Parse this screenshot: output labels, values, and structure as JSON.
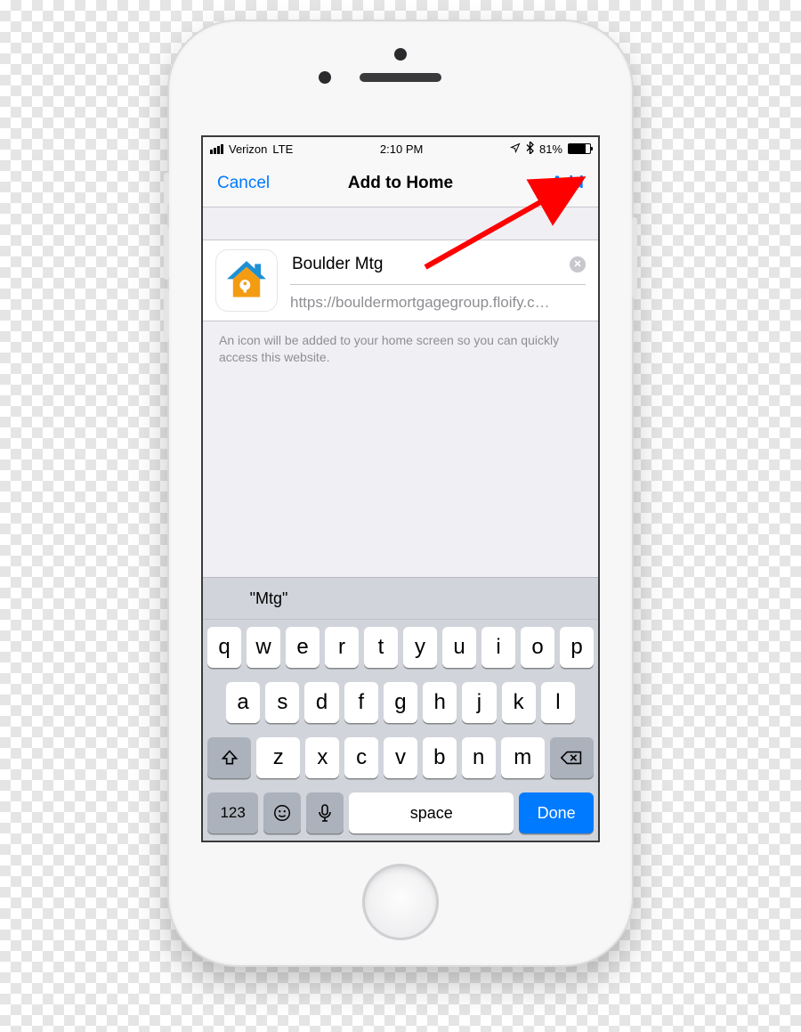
{
  "status": {
    "carrier": "Verizon",
    "network": "LTE",
    "time": "2:10 PM",
    "battery_pct": "81%"
  },
  "nav": {
    "cancel": "Cancel",
    "title": "Add to Home",
    "add": "Add"
  },
  "form": {
    "title_value": "Boulder Mtg",
    "url": "https://bouldermortgagegroup.floify.c…",
    "hint": "An icon will be added to your home screen so you can quickly access this website."
  },
  "keyboard": {
    "suggestion": "\"Mtg\"",
    "row1": [
      "q",
      "w",
      "e",
      "r",
      "t",
      "y",
      "u",
      "i",
      "o",
      "p"
    ],
    "row2": [
      "a",
      "s",
      "d",
      "f",
      "g",
      "h",
      "j",
      "k",
      "l"
    ],
    "row3_mid": [
      "z",
      "x",
      "c",
      "v",
      "b",
      "n",
      "m"
    ],
    "num_label": "123",
    "space_label": "space",
    "done_label": "Done"
  }
}
